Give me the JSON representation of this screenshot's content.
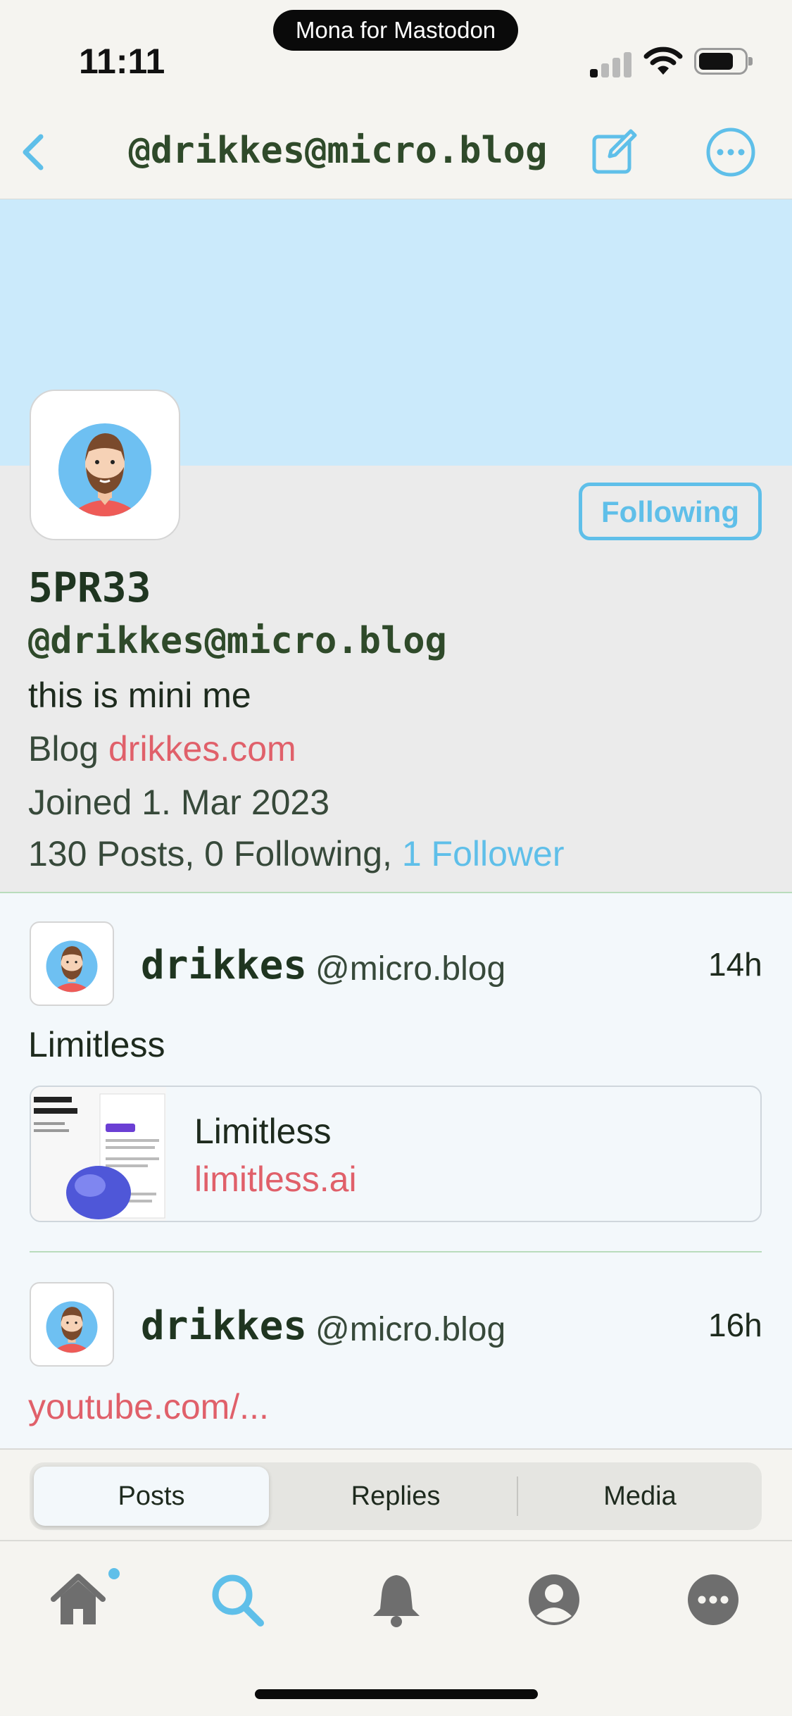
{
  "status_bar": {
    "pill_label": "Mona for Mastodon",
    "time": "11:11"
  },
  "nav": {
    "title": "@drikkes@micro.blog",
    "back_icon": "chevron-left-icon",
    "compose_icon": "compose-icon",
    "more_icon": "ellipsis-circle-icon"
  },
  "profile": {
    "follow_button": "Following",
    "display_name": "5PR33",
    "handle": "@drikkes@micro.blog",
    "bio": "this is mini me",
    "blog_label": "Blog",
    "blog_link": "drikkes.com",
    "joined": "Joined 1. Mar 2023",
    "stats_text": "130 Posts, 0 Following,",
    "followers_link": "1 Follower"
  },
  "posts": [
    {
      "name": "drikkes",
      "instance": "@micro.blog",
      "time": "14h",
      "text": "Limitless",
      "card": {
        "title": "Limitless",
        "host": "limitless.ai"
      }
    },
    {
      "name": "drikkes",
      "instance": "@micro.blog",
      "time": "16h",
      "link": "youtube.com/..."
    }
  ],
  "segments": [
    "Posts",
    "Replies",
    "Media"
  ],
  "active_segment": "Posts",
  "tab_bar": [
    "home-icon",
    "search-icon",
    "bell-icon",
    "person-icon",
    "more-icon"
  ],
  "colors": {
    "accent": "#5fbfe9",
    "link": "#e0606a",
    "banner": "#cbeafb",
    "title_green": "#2f4a2a"
  }
}
